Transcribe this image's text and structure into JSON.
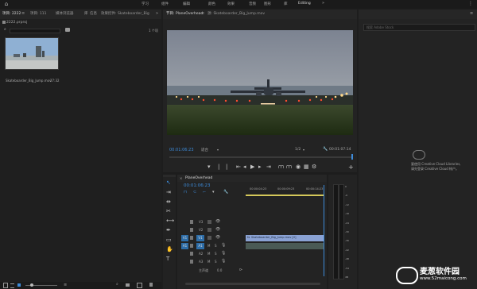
{
  "topbar": {
    "home_icon": "home-icon",
    "menu": [
      "学习",
      "组件",
      "编辑",
      "颜色",
      "效果",
      "音频",
      "图形",
      "库",
      "Editing"
    ],
    "expand": "»",
    "right_icon": "more-icon"
  },
  "project_panel": {
    "tabs": [
      "项目: 2222",
      "项目: 111",
      "媒体浏览器",
      "库",
      "信息",
      "效果控件: Skateboarder_Big"
    ],
    "menu_glyph": "≡",
    "expand": "»",
    "project_file": "2222.prproj",
    "item_count": "1 个项",
    "clip_name": "Skateboarder_Big_Jump.mov",
    "clip_duration": "27:32"
  },
  "program_monitor": {
    "tabs": [
      "节目: PlaneOverhead",
      "源: Skateboarder_Big_Jump.mov"
    ],
    "menu_glyph": "≡",
    "timecode": "00:01:06:23",
    "fit_label": "适合",
    "ratio": "1/2",
    "duration": "00:01:07:14"
  },
  "timeline": {
    "sequence_name": "PlaneOverhead",
    "timecode": "00:01:06:23",
    "ruler_labels": [
      "00:00:04:23",
      "00:00:09:23",
      "00:00:14:23"
    ],
    "video_tracks": [
      "V3",
      "V2",
      "V1"
    ],
    "audio_tracks": [
      "A1",
      "A2",
      "A3"
    ],
    "source_video": "V1",
    "source_audio": "A1",
    "master_label": "主声道",
    "master_value": "0.0",
    "clip_label": "Skateboarder_Big_Jump.mov [V]",
    "fx_badge": "fx",
    "meter_scale": [
      "0",
      "-6",
      "-12",
      "-18",
      "-24",
      "-30",
      "-36",
      "-42",
      "-48",
      "-54",
      "dB"
    ]
  },
  "libraries": {
    "search_placeholder": "搜索 Adobe Stock",
    "promo_line1": "要使用 Creative Cloud Libraries,",
    "promo_line2": "请先登录 Creative Cloud 帐户。"
  },
  "watermark": {
    "site_cn": "麦葱软件园",
    "site_url": "www.52maicong.com"
  },
  "colors": {
    "accent": "#3d8bd9",
    "clip": "#8aa2d4",
    "playhead": "#3d8bd9"
  }
}
